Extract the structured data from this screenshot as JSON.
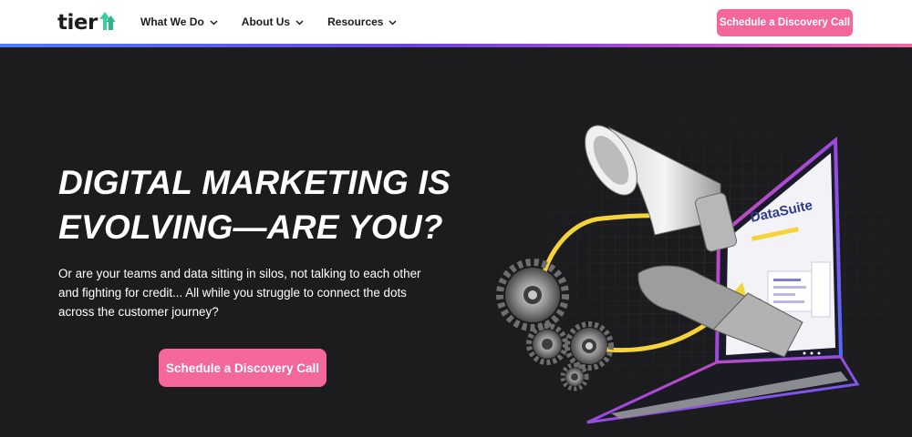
{
  "header": {
    "logo_text": "tier",
    "nav": [
      {
        "label": "What We Do"
      },
      {
        "label": "About Us"
      },
      {
        "label": "Resources"
      }
    ],
    "cta_label": "Schedule a Discovery Call"
  },
  "hero": {
    "headline_line1": "DIGITAL MARKETING IS",
    "headline_line2": "EVOLVING—ARE YOU?",
    "subtext": "Or are your teams and data sitting in silos, not talking to each other and fighting for credit... All while you struggle to connect the dots across the customer journey?",
    "cta_label": "Schedule a Discovery Call",
    "screen_title": "DataSuite"
  },
  "colors": {
    "accent_pink": "#f4679b",
    "logo_green": "#3ecf9f",
    "hero_bg": "#1c1c1e",
    "arrow_yellow": "#f5d33a"
  }
}
